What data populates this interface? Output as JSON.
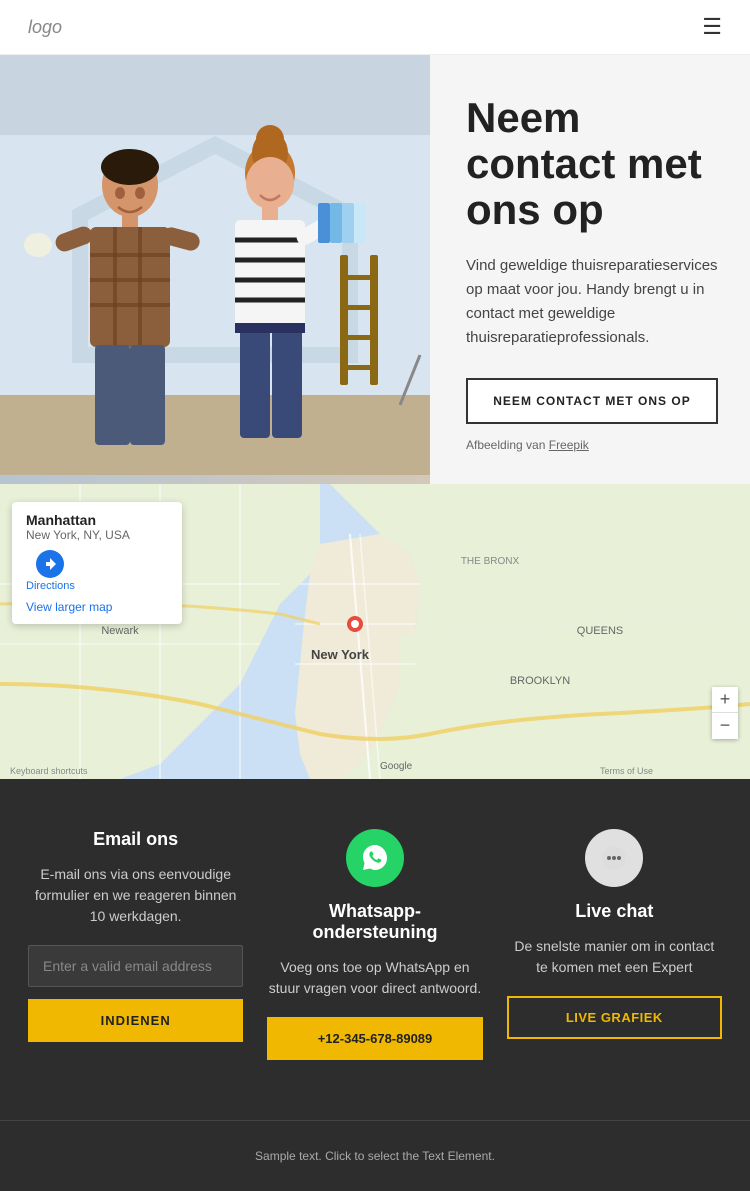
{
  "navbar": {
    "logo": "logo",
    "menu_icon": "☰"
  },
  "hero": {
    "title": "Neem contact met ons op",
    "description": "Vind geweldige thuisreparatieservices op maat voor jou. Handy brengt u in contact met geweldige thuisreparatieprofessionals.",
    "cta_label": "NEEM CONTACT MET ONS OP",
    "image_credit_prefix": "Afbeelding van ",
    "image_credit_link": "Freepik"
  },
  "map": {
    "card_title": "Manhattan",
    "card_subtitle": "New York, NY, USA",
    "directions_label": "Directions",
    "view_larger": "View larger map",
    "zoom_in": "+",
    "zoom_out": "−"
  },
  "dark_section": {
    "email_col": {
      "title": "Email ons",
      "description": "E-mail ons via ons eenvoudige formulier en we reageren binnen 10 werkdagen.",
      "input_placeholder": "Enter a valid email address",
      "button_label": "INDIENEN"
    },
    "whatsapp_col": {
      "title": "Whatsapp-ondersteuning",
      "description": "Voeg ons toe op WhatsApp en stuur vragen voor direct antwoord.",
      "phone": "+12-345-678-89089"
    },
    "livechat_col": {
      "title": "Live chat",
      "description": "De snelste manier om in contact te komen met een Expert",
      "button_label": "LIVE GRAFIEK"
    }
  },
  "footer": {
    "text": "Sample text. Click to select the Text Element."
  }
}
